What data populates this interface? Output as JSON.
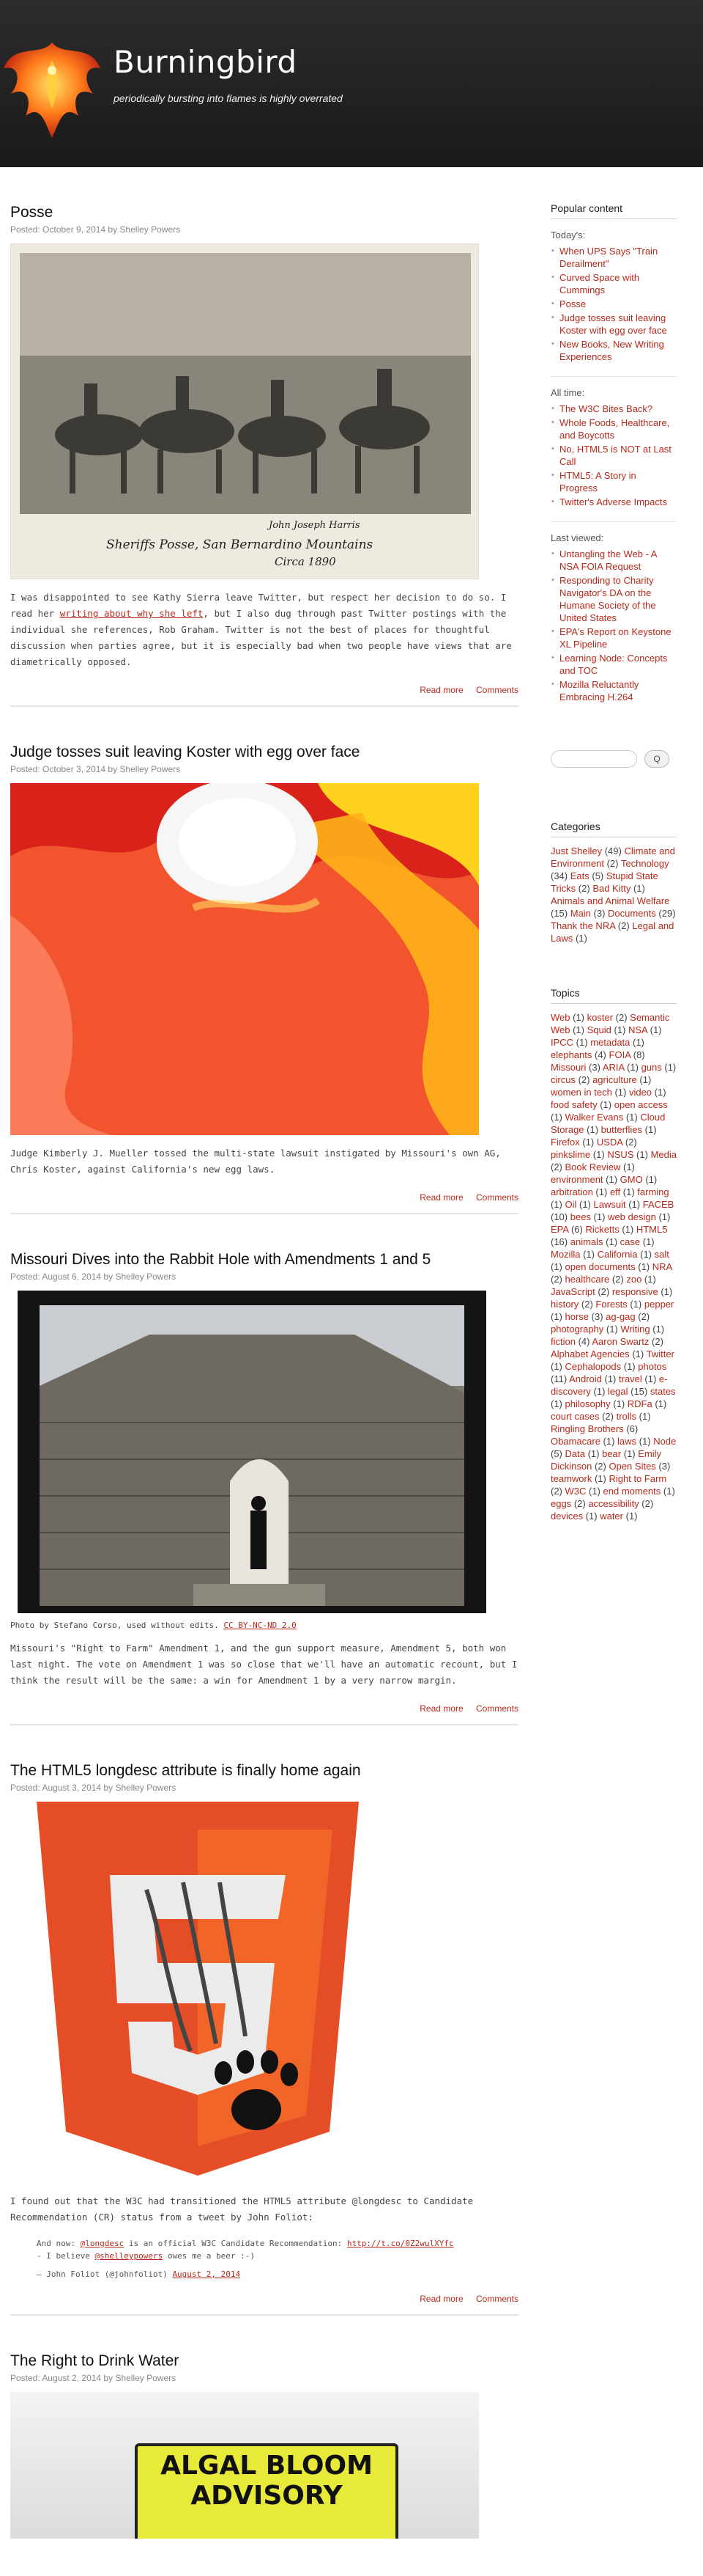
{
  "site": {
    "title": "Burningbird",
    "description": "periodically bursting into flames is highly overrated"
  },
  "posts": [
    {
      "title": "Posse",
      "meta": "Posted: October 9, 2014 by Shelley Powers",
      "image_caption_lines": [
        "John Joseph Harris",
        "Sheriffs Posse, San Bernardino Mountains",
        "Circa 1890"
      ],
      "text_1": "I was disappointed to see Kathy Sierra leave Twitter, but respect her decision to do so. I read her ",
      "link_1": "writing about why she left",
      "text_2": ", but I also dug through past Twitter postings with the individual she references, Rob Graham. Twitter is not the best of places for thoughtful discussion when parties agree, but it is especially bad when two people have views that are diametrically opposed.",
      "read_more": "Read more",
      "comments": "Comments"
    },
    {
      "title": "Judge tosses suit leaving Koster with egg over face",
      "meta": "Posted: October 3, 2014 by Shelley Powers",
      "text": "Judge Kimberly J. Mueller tossed the multi-state lawsuit instigated by Missouri's own AG, Chris Koster, against California's new egg laws.",
      "read_more": "Read more",
      "comments": "Comments"
    },
    {
      "title": "Missouri Dives into the Rabbit Hole with Amendments 1 and 5",
      "meta": "Posted: August 6, 2014 by Shelley Powers",
      "photo_credit": "Photo by Stefano Corso, used without edits. ",
      "license_link": "CC BY-NC-ND 2.0",
      "text": "Missouri's \"Right to Farm\" Amendment 1, and the gun support measure, Amendment 5, both won last night. The vote on Amendment 1 was so close that we'll have an automatic recount, but I think the result will be the same: a win for Amendment 1 by a very narrow margin.",
      "read_more": "Read more",
      "comments": "Comments"
    },
    {
      "title": "The HTML5 longdesc attribute is finally home again",
      "meta": "Posted: August 3, 2014 by Shelley Powers",
      "text": "I found out that the W3C had transitioned the HTML5 attribute @longdesc to Candidate Recommendation (CR) status from a tweet by John Foliot:",
      "quote_1a": "And now: ",
      "quote_1b": "@longdesc",
      "quote_1c": " is an official W3C Candidate Recommendation: ",
      "quote_1d": "http://t.co/0Z2wulXYfc",
      "quote_2a": "- I believe ",
      "quote_2b": "@shelleypowers",
      "quote_2c": " owes me a beer :-)",
      "quote_src_a": "— John Foliot (@johnfoliot) ",
      "quote_src_b": "August 2, 2014",
      "read_more": "Read more",
      "comments": "Comments"
    },
    {
      "title": "The Right to Drink Water",
      "meta": "Posted: August 2, 2014 by Shelley Powers",
      "sign_line_1": "ALGAL BLOOM",
      "sign_line_2": "ADVISORY"
    }
  ],
  "sidebar": {
    "popular_heading": "Popular content",
    "today_label": "Today's:",
    "today": [
      "When UPS Says \"Train Derailment\"",
      "Curved Space with Cummings",
      "Posse",
      "Judge tosses suit leaving Koster with egg over face",
      "New Books, New Writing Experiences"
    ],
    "alltime_label": "All time:",
    "alltime": [
      "The W3C Bites Back?",
      "Whole Foods, Healthcare, and Boycotts",
      "No, HTML5 is NOT at Last Call",
      "HTML5: A Story in Progress",
      "Twitter's Adverse Impacts"
    ],
    "lastviewed_label": "Last viewed:",
    "lastviewed": [
      "Untangling the Web - A NSA FOIA Request",
      "Responding to Charity Navigator's DA on the Humane Society of the United States",
      "EPA's Report on Keystone XL Pipeline",
      "Learning Node: Concepts and TOC",
      "Mozilla Reluctantly Embracing H.264"
    ],
    "search_button": "Q",
    "categories_heading": "Categories",
    "categories": [
      [
        "Just Shelley",
        "(49)"
      ],
      [
        "Climate and Environment",
        "(2)"
      ],
      [
        "Technology",
        "(34)"
      ],
      [
        "Eats",
        "(5)"
      ],
      [
        "Stupid State Tricks",
        "(2)"
      ],
      [
        "Bad Kitty",
        "(1)"
      ],
      [
        "Animals and Animal Welfare",
        "(15)"
      ],
      [
        "Main",
        "(3)"
      ],
      [
        "Documents",
        "(29)"
      ],
      [
        "Thank the NRA",
        "(2)"
      ],
      [
        "Legal and Laws",
        "(1)"
      ]
    ],
    "topics_heading": "Topics",
    "topics": [
      [
        "Web",
        "(1)"
      ],
      [
        "koster",
        "(2)"
      ],
      [
        "Semantic Web",
        "(1)"
      ],
      [
        "Squid",
        "(1)"
      ],
      [
        "NSA",
        "(1)"
      ],
      [
        "IPCC",
        "(1)"
      ],
      [
        "metadata",
        "(1)"
      ],
      [
        "elephants",
        "(4)"
      ],
      [
        "FOIA",
        "(8)"
      ],
      [
        "Missouri",
        "(3)"
      ],
      [
        "ARIA",
        "(1)"
      ],
      [
        "guns",
        "(1)"
      ],
      [
        "circus",
        "(2)"
      ],
      [
        "agriculture",
        "(1)"
      ],
      [
        "women in tech",
        "(1)"
      ],
      [
        "video",
        "(1)"
      ],
      [
        "food safety",
        "(1)"
      ],
      [
        "open access",
        "(1)"
      ],
      [
        "Walker Evans",
        "(1)"
      ],
      [
        "Cloud Storage",
        "(1)"
      ],
      [
        "butterflies",
        "(1)"
      ],
      [
        "Firefox",
        "(1)"
      ],
      [
        "USDA",
        "(2)"
      ],
      [
        "pinkslime",
        "(1)"
      ],
      [
        "NSUS",
        "(1)"
      ],
      [
        "Media",
        "(2)"
      ],
      [
        "Book Review",
        "(1)"
      ],
      [
        "environment",
        "(1)"
      ],
      [
        "GMO",
        "(1)"
      ],
      [
        "arbitration",
        "(1)"
      ],
      [
        "eff",
        "(1)"
      ],
      [
        "farming",
        "(1)"
      ],
      [
        "Oil",
        "(1)"
      ],
      [
        "Lawsuit",
        "(1)"
      ],
      [
        "FACEB",
        "(10)"
      ],
      [
        "bees",
        "(1)"
      ],
      [
        "web design",
        "(1)"
      ],
      [
        "EPA",
        "(6)"
      ],
      [
        "Ricketts",
        "(1)"
      ],
      [
        "HTML5",
        "(16)"
      ],
      [
        "animals",
        "(1)"
      ],
      [
        "case",
        "(1)"
      ],
      [
        "Mozilla",
        "(1)"
      ],
      [
        "California",
        "(1)"
      ],
      [
        "salt",
        "(1)"
      ],
      [
        "open documents",
        "(1)"
      ],
      [
        "NRA",
        "(2)"
      ],
      [
        "healthcare",
        "(2)"
      ],
      [
        "zoo",
        "(1)"
      ],
      [
        "JavaScript",
        "(2)"
      ],
      [
        "responsive",
        "(1)"
      ],
      [
        "history",
        "(2)"
      ],
      [
        "Forests",
        "(1)"
      ],
      [
        "pepper",
        "(1)"
      ],
      [
        "horse",
        "(3)"
      ],
      [
        "ag-gag",
        "(2)"
      ],
      [
        "photography",
        "(1)"
      ],
      [
        "Writing",
        "(1)"
      ],
      [
        "fiction",
        "(4)"
      ],
      [
        "Aaron Swartz",
        "(2)"
      ],
      [
        "Alphabet Agencies",
        "(1)"
      ],
      [
        "Twitter",
        "(1)"
      ],
      [
        "Cephalopods",
        "(1)"
      ],
      [
        "photos",
        "(11)"
      ],
      [
        "Android",
        "(1)"
      ],
      [
        "travel",
        "(1)"
      ],
      [
        "e-discovery",
        "(1)"
      ],
      [
        "legal",
        "(15)"
      ],
      [
        "states",
        "(1)"
      ],
      [
        "philosophy",
        "(1)"
      ],
      [
        "RDFa",
        "(1)"
      ],
      [
        "court cases",
        "(2)"
      ],
      [
        "trolls",
        "(1)"
      ],
      [
        "Ringling Brothers",
        "(6)"
      ],
      [
        "Obamacare",
        "(1)"
      ],
      [
        "laws",
        "(1)"
      ],
      [
        "Node",
        "(5)"
      ],
      [
        "Data",
        "(1)"
      ],
      [
        "bear",
        "(1)"
      ],
      [
        "Emily Dickinson",
        "(2)"
      ],
      [
        "Open Sites",
        "(3)"
      ],
      [
        "teamwork",
        "(1)"
      ],
      [
        "Right to Farm",
        "(2)"
      ],
      [
        "W3C",
        "(1)"
      ],
      [
        "end moments",
        "(1)"
      ],
      [
        "eggs",
        "(2)"
      ],
      [
        "accessibility",
        "(2)"
      ],
      [
        "devices",
        "(1)"
      ],
      [
        "water",
        "(1)"
      ]
    ]
  },
  "colors": {
    "link": "#b52a1c",
    "header": "#222222"
  }
}
